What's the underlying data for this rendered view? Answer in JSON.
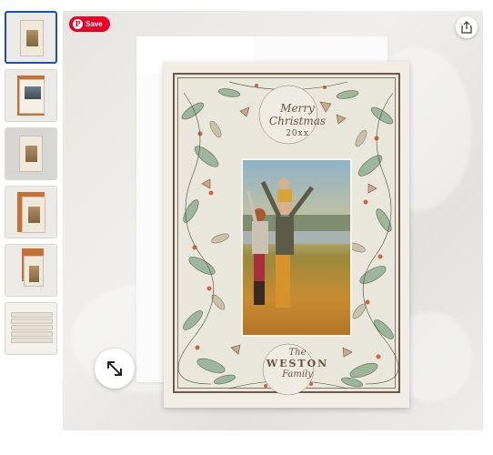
{
  "save_button": {
    "label": "Save",
    "icon": "pinterest-icon"
  },
  "share_button": {
    "icon": "share-icon"
  },
  "expand_button": {
    "icon": "expand-arrows-icon"
  },
  "thumbnails": [
    {
      "name": "thumbnail-1",
      "selected": true
    },
    {
      "name": "thumbnail-2",
      "selected": false
    },
    {
      "name": "thumbnail-3",
      "selected": false
    },
    {
      "name": "thumbnail-4",
      "selected": false
    },
    {
      "name": "thumbnail-5",
      "selected": false
    },
    {
      "name": "thumbnail-6",
      "selected": false
    }
  ],
  "card": {
    "greeting_line1": "Merry",
    "greeting_line2": "Christmas",
    "year": "20xx",
    "family_prefix": "The",
    "family_name": "WESTON",
    "family_suffix": "Family"
  },
  "colors": {
    "save_red": "#e60023",
    "selected_border": "#1b4fb6",
    "card_ink": "#6a5140"
  }
}
